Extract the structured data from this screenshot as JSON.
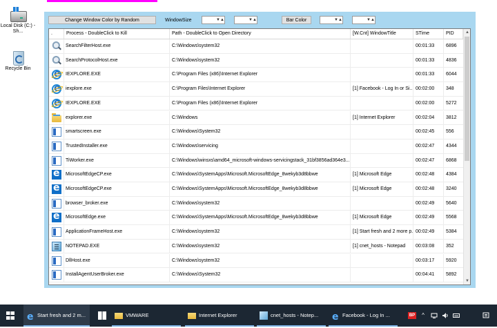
{
  "desktop": {
    "icons": [
      {
        "label": "Local Disk (C:) - Sh...",
        "icon": "disk-icon"
      },
      {
        "label": "Recycle Bin",
        "icon": "recycle-bin-icon"
      }
    ]
  },
  "toolbar": {
    "random_color_label": "Change Window Color by Random",
    "window_size_label": "WindowSize",
    "bar_color_label": "Bar Color",
    "up_arrow": "▲",
    "down_arrow": "▼"
  },
  "list": {
    "columns": [
      ".",
      "Process - DoubleClick to Kill",
      "Path - DoubleClick to Open Directory",
      "[W.Cnt] WindowTitle",
      "STime",
      "PID"
    ],
    "rows": [
      {
        "icon": "search",
        "process": "SearchFilterHost.exe",
        "path": "C:\\Windows\\system32",
        "title": "",
        "stime": "00:01:33",
        "pid": "6896"
      },
      {
        "icon": "search",
        "process": "SearchProtocolHost.exe",
        "path": "C:\\Windows\\system32",
        "title": "",
        "stime": "00:01:33",
        "pid": "4836"
      },
      {
        "icon": "ie",
        "process": "IEXPLORE.EXE",
        "path": "C:\\Program Files (x86)\\Internet Explorer",
        "title": "",
        "stime": "00:01:33",
        "pid": "6044"
      },
      {
        "icon": "ie",
        "process": "iexplore.exe",
        "path": "C:\\Program Files\\Internet Explorer",
        "title": "[1] Facebook - Log In or Si...",
        "stime": "00:02:00",
        "pid": "348"
      },
      {
        "icon": "ie",
        "process": "IEXPLORE.EXE",
        "path": "C:\\Program Files (x86)\\Internet Explorer",
        "title": "",
        "stime": "00:02:00",
        "pid": "5272"
      },
      {
        "icon": "folder",
        "process": "explorer.exe",
        "path": "C:\\Windows",
        "title": "[1] Internet Explorer",
        "stime": "00:02:04",
        "pid": "3812"
      },
      {
        "icon": "app",
        "process": "smartscreen.exe",
        "path": "C:\\Windows\\System32",
        "title": "",
        "stime": "00:02:45",
        "pid": "556"
      },
      {
        "icon": "app",
        "process": "TrustedInstaller.exe",
        "path": "C:\\Windows\\servicing",
        "title": "",
        "stime": "00:02:47",
        "pid": "4344"
      },
      {
        "icon": "app",
        "process": "TiWorker.exe",
        "path": "C:\\Windows\\winsxs\\amd64_microsoft-windows-servicingstack_31bf3856ad364e3...",
        "title": "",
        "stime": "00:02:47",
        "pid": "6868"
      },
      {
        "icon": "edge",
        "process": "MicrosoftEdgeCP.exe",
        "path": "C:\\Windows\\SystemApps\\Microsoft.MicrosoftEdge_8wekyb3d8bbwe",
        "title": "[1] Microsoft Edge",
        "stime": "00:02:48",
        "pid": "4384"
      },
      {
        "icon": "edge",
        "process": "MicrosoftEdgeCP.exe",
        "path": "C:\\Windows\\SystemApps\\Microsoft.MicrosoftEdge_8wekyb3d8bbwe",
        "title": "[1] Microsoft Edge",
        "stime": "00:02:48",
        "pid": "3240"
      },
      {
        "icon": "app",
        "process": "browser_broker.exe",
        "path": "C:\\Windows\\system32",
        "title": "",
        "stime": "00:02:49",
        "pid": "5640"
      },
      {
        "icon": "edge",
        "process": "MicrosoftEdge.exe",
        "path": "C:\\Windows\\SystemApps\\Microsoft.MicrosoftEdge_8wekyb3d8bbwe",
        "title": "[1] Microsoft Edge",
        "stime": "00:02:49",
        "pid": "5568"
      },
      {
        "icon": "app",
        "process": "ApplicationFrameHost.exe",
        "path": "C:\\Windows\\system32",
        "title": "[1] Start fresh and 2 more p...",
        "stime": "00:02:49",
        "pid": "5384"
      },
      {
        "icon": "notepad",
        "process": "NOTEPAD.EXE",
        "path": "C:\\Windows\\system32",
        "title": "[1] cnet_hosts - Notepad",
        "stime": "00:03:08",
        "pid": "352"
      },
      {
        "icon": "app",
        "process": "DllHost.exe",
        "path": "C:\\Windows\\system32",
        "title": "",
        "stime": "00:03:17",
        "pid": "5920"
      },
      {
        "icon": "app",
        "process": "InstallAgentUserBroker.exe",
        "path": "C:\\Windows\\System32",
        "title": "",
        "stime": "00:04:41",
        "pid": "5892"
      }
    ]
  },
  "taskbar": {
    "items": [
      {
        "id": "task-ie1",
        "label": "Start fresh and 2 m...",
        "icon": "ie"
      },
      {
        "id": "task-vmware",
        "label": "VMWARE",
        "icon": "folder"
      },
      {
        "id": "task-explorer",
        "label": "Internet Explorer",
        "icon": "folder"
      },
      {
        "id": "task-notepad",
        "label": "cnet_hosts - Notep...",
        "icon": "notepad"
      },
      {
        "id": "task-facebook",
        "label": "Facebook - Log In ...",
        "icon": "ie"
      }
    ],
    "tray": {
      "bp_label": "BP",
      "up_arrow": "^"
    }
  }
}
